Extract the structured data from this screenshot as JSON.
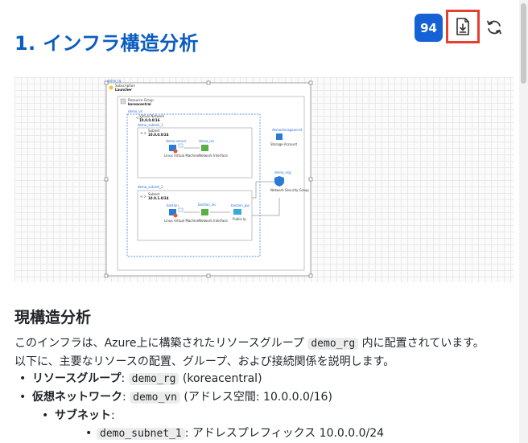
{
  "header": {
    "title": "1. インフラ構造分析",
    "score": "94",
    "export_icon": "file-download-icon",
    "refresh_icon": "refresh-icon",
    "accent_color": "#1561d6",
    "highlight_color": "#e43f2f"
  },
  "diagram": {
    "subscription_label": "Subscription",
    "subscription_name": "Launcher",
    "top_label": "demo_rg",
    "rg_type": "Resource Group",
    "rg_location": "koreacentral",
    "vnet_name": "demo_vn",
    "vnet_type": "Virtual Network",
    "vnet_cidr": "10.0.0.0/16",
    "subnet1_name": "demo_subnet_1",
    "subnet1_type": "Subnet",
    "subnet1_cidr": "10.0.0.0/24",
    "vm1_name": "demo-server",
    "vm1_type": "Linux Virtual Machine",
    "nic1_name": "demo_nic",
    "nic1_type": "Network Interface",
    "storage_name": "demostorageaccnt",
    "storage_type": "Storage Account",
    "nsg_name": "demo_nsg",
    "nsg_type": "Network Security Group",
    "subnet2_name": "demo_subnet_2",
    "subnet2_type": "Subnet",
    "subnet2_cidr": "10.0.1.0/24",
    "vm2_name": "bastion",
    "vm2_type": "Linux Virtual Machine",
    "nic2_name": "bastion_nic",
    "nic2_type": "Network Interface",
    "pip_name": "bastion_pip",
    "pip_type": "Public Ip"
  },
  "content": {
    "section_title": "現構造分析",
    "intro_pre": "このインフラは、Azure上に構築されたリソースグループ",
    "intro_code": "demo_rg",
    "intro_post": "内に配置されています。以下に、主要なリソースの配置、グループ、および接続関係を説明します。",
    "rg_label": "リソースグループ",
    "rg_code": "demo_rg",
    "rg_extra": "(koreacentral)",
    "vn_label": "仮想ネットワーク",
    "vn_code": "demo_vn",
    "vn_extra": "(アドレス空間: 10.0.0.0/16)",
    "subnet_label": "サブネット",
    "subnet1_code": "demo_subnet_1",
    "subnet1_text": ": アドレスプレフィックス 10.0.0.0/24"
  }
}
